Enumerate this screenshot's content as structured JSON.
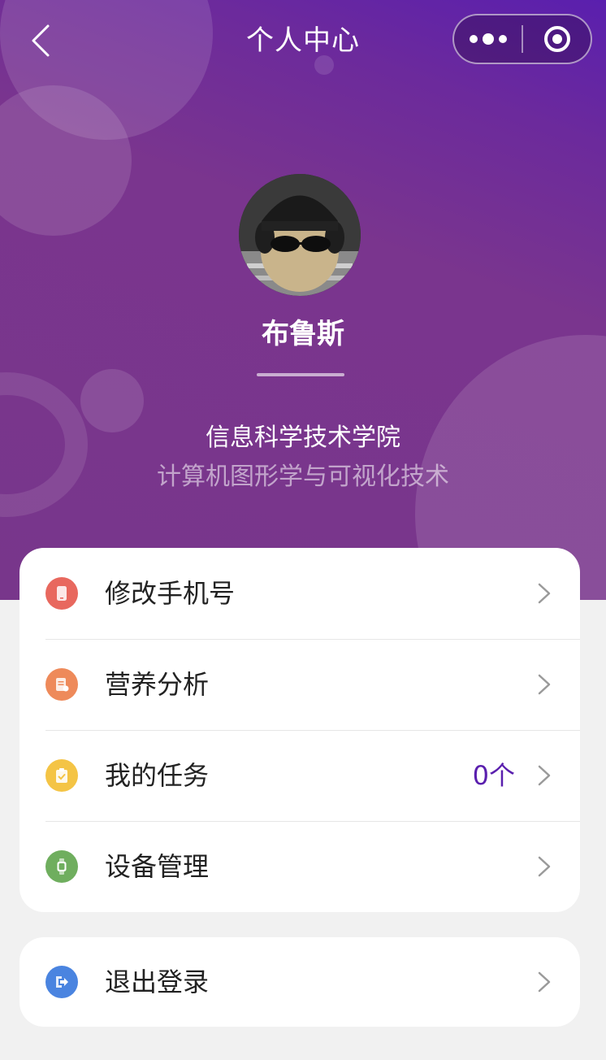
{
  "nav": {
    "title": "个人中心",
    "back_icon": "chevron-left-icon",
    "more_icon": "more-dots-icon",
    "close_icon": "target-close-icon"
  },
  "profile": {
    "avatar": "avatar-photo",
    "name": "布鲁斯",
    "college": "信息科学技术学院",
    "major": "计算机图形学与可视化技术"
  },
  "menu": [
    {
      "label": "修改手机号",
      "icon": "phone-icon",
      "color": "#e8685e"
    },
    {
      "label": "营养分析",
      "icon": "report-icon",
      "color": "#ee8a5a"
    },
    {
      "label": "我的任务",
      "icon": "clipboard-check-icon",
      "color": "#f4c445",
      "count": "0个"
    },
    {
      "label": "设备管理",
      "icon": "watch-icon",
      "color": "#6fae5e"
    }
  ],
  "logout": {
    "label": "退出登录",
    "icon": "logout-icon",
    "color": "#4a84e0"
  },
  "colors": {
    "accent": "#5a1fae",
    "header_gradient_start": "#5a1fae",
    "header_gradient_end": "#78368b",
    "page_bg": "#f1f1f1"
  }
}
